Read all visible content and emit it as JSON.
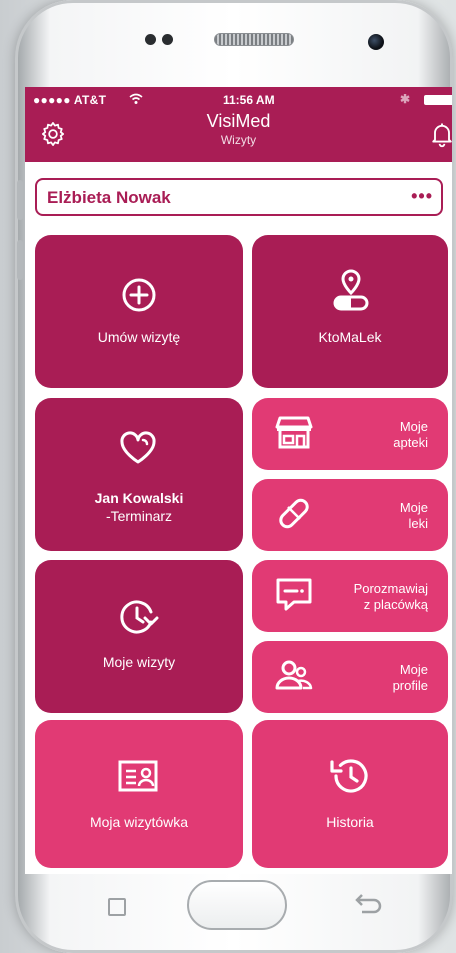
{
  "status_bar": {
    "carrier": "●●●●● AT&T",
    "time": "11:56 AM",
    "bluetooth": "✱"
  },
  "header": {
    "title": "VisiMed",
    "subtitle": "Wizyty",
    "settings_icon": "gear-icon",
    "notifications_icon": "bell-icon"
  },
  "patient": {
    "name": "Elżbieta Nowak",
    "more": "•••"
  },
  "tiles": {
    "book_visit": {
      "label": "Umów wizytę",
      "icon": "plus-circle-icon"
    },
    "kto_ma_lek": {
      "label": "KtoMaLek",
      "icon": "pill-location-icon"
    },
    "schedule": {
      "name": "Jan Kowalski",
      "label": "-Terminarz",
      "icon": "heart-icon"
    },
    "pharmacies": {
      "line1": "Moje",
      "line2": "apteki",
      "icon": "store-icon"
    },
    "medicines": {
      "line1": "Moje",
      "line2": "leki",
      "icon": "pill-icon"
    },
    "chat": {
      "line1": "Porozmawiaj",
      "line2": "z placówką",
      "icon": "chat-icon"
    },
    "profiles": {
      "line1": "Moje",
      "line2": "profile",
      "icon": "users-icon"
    },
    "my_visits": {
      "label": "Moje wizyty",
      "icon": "clock-refresh-icon"
    },
    "business_card": {
      "label": "Moja wizytówka",
      "icon": "id-card-icon"
    },
    "history": {
      "label": "Historia",
      "icon": "history-icon"
    }
  },
  "colors": {
    "primary": "#a91d55",
    "accent": "#e13a74",
    "background": "#ffffff"
  }
}
